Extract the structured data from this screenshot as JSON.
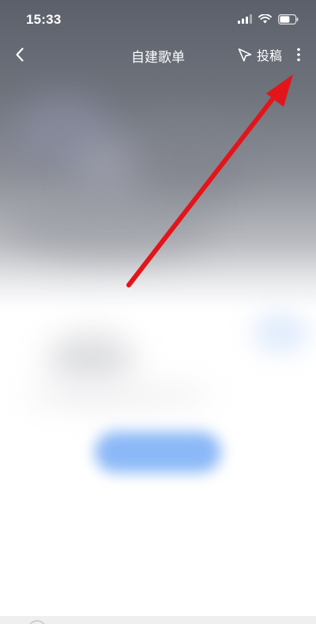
{
  "status_bar": {
    "time": "15:33",
    "icons": [
      "signal-icon",
      "wifi-icon",
      "battery-icon"
    ]
  },
  "nav": {
    "title": "自建歌单",
    "submit_label": "投稿",
    "icons": {
      "back": "chevron-left-icon",
      "submit": "paper-plane-icon",
      "more": "more-vertical-icon"
    }
  },
  "colors": {
    "annotation_arrow": "#e3151a",
    "header_overlay": "#5a5f69",
    "blurred_button": "#7fb1f6",
    "text_on_header": "#ffffff"
  }
}
